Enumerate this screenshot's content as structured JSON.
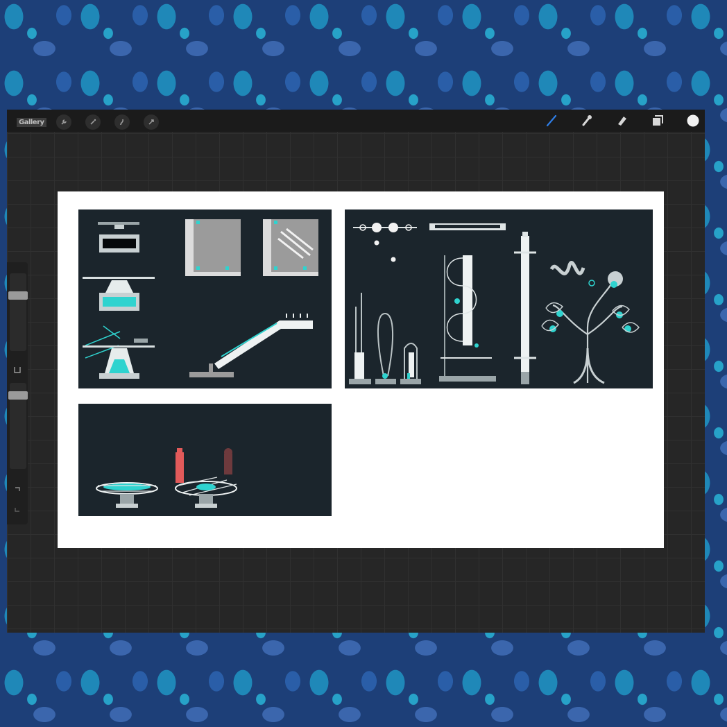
{
  "toolbar": {
    "gallery_label": "Gallery",
    "left_buttons": [
      "wrench-icon",
      "magic-wand-icon",
      "selection-icon",
      "transform-icon"
    ],
    "right_tools": [
      "brush-icon",
      "smudge-icon",
      "eraser-icon",
      "layers-icon",
      "color-icon"
    ],
    "active_tool": "brush-icon",
    "accent_color": "#2f7ee6"
  },
  "sidebar": {
    "brush_size_level": 0.45,
    "opacity_level": 0.55,
    "modify_button": "square-modifier-icon",
    "undo": "undo-icon",
    "redo": "redo-icon"
  },
  "canvas": {
    "background": "#ffffff",
    "panel_color": "#1b252c",
    "accent_cyan": "#2fd3cf",
    "accent_red": "#e25a5a",
    "panels": [
      {
        "id": "apparatus-sheet",
        "contents": [
          "device-closed",
          "device-loading",
          "device-active",
          "frame-empty",
          "frame-marked",
          "cannon-arm"
        ]
      },
      {
        "id": "tower-sheet",
        "contents": [
          "bead-rod",
          "bar-rod",
          "tall-flask",
          "loop-column",
          "small-chamber",
          "coil-column",
          "pillar",
          "crystal-tree"
        ]
      },
      {
        "id": "platform-sheet",
        "contents": [
          "glowing-platform",
          "platform-with-markers"
        ]
      }
    ]
  }
}
